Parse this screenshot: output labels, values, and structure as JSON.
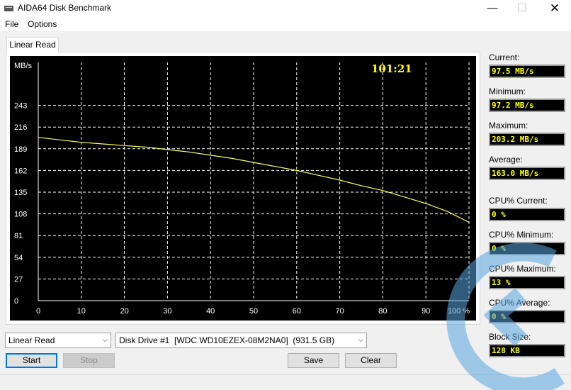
{
  "window": {
    "title": "AIDA64 Disk Benchmark",
    "minimize_glyph": "—",
    "maximize_glyph": "☐",
    "close_glyph": "✕"
  },
  "menu": {
    "items": [
      "File",
      "Options"
    ]
  },
  "tab": {
    "label": "Linear Read"
  },
  "chart": {
    "timer": "101:21"
  },
  "chart_data": {
    "type": "line",
    "title": "",
    "ylabel": "MB/s",
    "xlabel": "",
    "ylim": [
      0,
      270
    ],
    "xlim": [
      0,
      100
    ],
    "y_ticks": [
      "243",
      "216",
      "189",
      "162",
      "135",
      "108",
      "81",
      "54",
      "27",
      "0"
    ],
    "x_ticks": [
      "0",
      "10",
      "20",
      "30",
      "40",
      "50",
      "60",
      "70",
      "80",
      "90",
      "100 %"
    ],
    "grid": true,
    "series": [
      {
        "color": "#ffff66",
        "x": [
          0,
          5,
          10,
          15,
          20,
          25,
          30,
          35,
          40,
          45,
          50,
          55,
          60,
          65,
          70,
          75,
          80,
          85,
          90,
          95,
          100
        ],
        "values": [
          203.2,
          200,
          197,
          195,
          193,
          191,
          188,
          185,
          181,
          177,
          172,
          167,
          162,
          156,
          150,
          143,
          137,
          129,
          121,
          111,
          97.5
        ]
      }
    ]
  },
  "stats": [
    {
      "label": "Current:",
      "value": "97.5 MB/s"
    },
    {
      "label": "Minimum:",
      "value": "97.2 MB/s"
    },
    {
      "label": "Maximum:",
      "value": "203.2 MB/s"
    },
    {
      "label": "Average:",
      "value": "163.0 MB/s"
    },
    {
      "label": "CPU% Current:",
      "value": "0 %"
    },
    {
      "label": "CPU% Minimum:",
      "value": "0 %"
    },
    {
      "label": "CPU% Maximum:",
      "value": "13 %"
    },
    {
      "label": "CPU% Average:",
      "value": "0 %"
    },
    {
      "label": "Block Size:",
      "value": "128 KB"
    }
  ],
  "controls": {
    "test_select": "Linear Read",
    "drive_select": "Disk Drive #1  [WDC WD10EZEX-08M2NA0]  (931.5 GB)",
    "dropdown_glyph": "⌵",
    "start_label": "Start",
    "stop_label": "Stop",
    "save_label": "Save",
    "clear_label": "Clear"
  },
  "colors": {
    "chart_bg": "#000000",
    "grid": "#ffffff",
    "line": "#ffff66",
    "value_text": "#ffff00",
    "accent": "#0078d7"
  }
}
